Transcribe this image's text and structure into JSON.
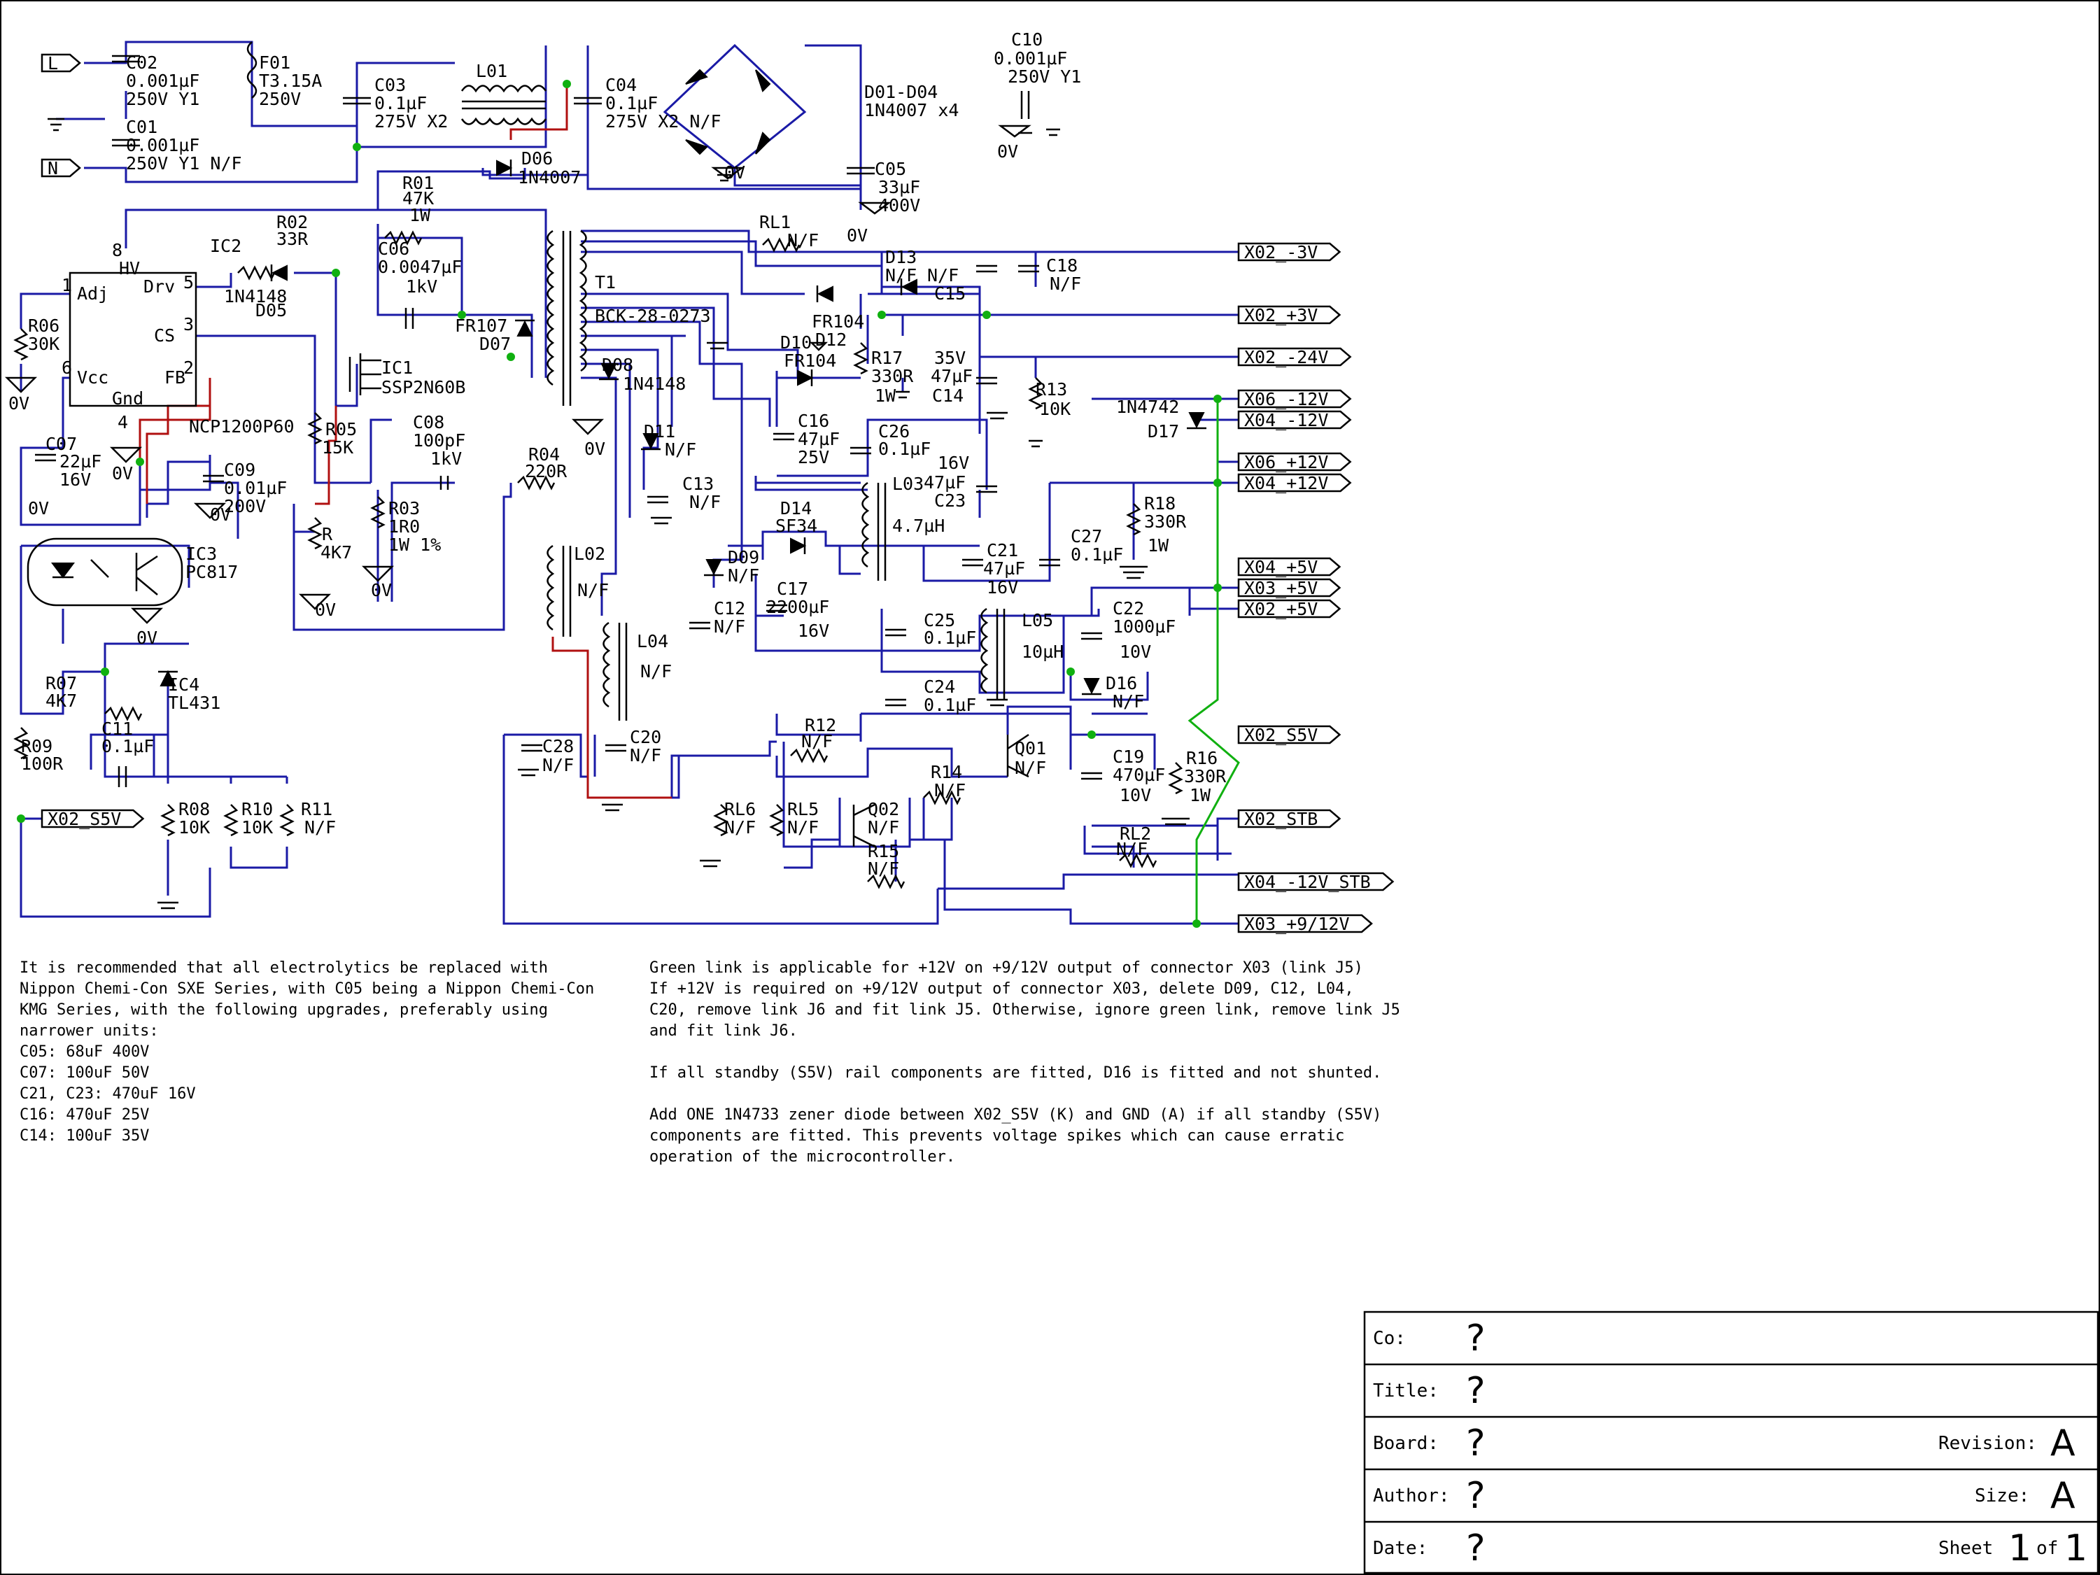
{
  "netlabels": [
    {
      "id": "L",
      "text": "L"
    },
    {
      "id": "N",
      "text": "N"
    },
    {
      "id": "x02_m3v",
      "text": "X02_-3V"
    },
    {
      "id": "x02_p3v",
      "text": "X02_+3V"
    },
    {
      "id": "x02_m24v",
      "text": "X02_-24V"
    },
    {
      "id": "x06_m12v",
      "text": "X06_-12V"
    },
    {
      "id": "x04_m12v",
      "text": "X04_-12V"
    },
    {
      "id": "x06_p12v",
      "text": "X06_+12V"
    },
    {
      "id": "x04_p12v",
      "text": "X04_+12V"
    },
    {
      "id": "x04_p5v",
      "text": "X04_+5V"
    },
    {
      "id": "x03_p5v",
      "text": "X03_+5V"
    },
    {
      "id": "x02_p5v",
      "text": "X02_+5V"
    },
    {
      "id": "x02_s5v",
      "text": "X02_S5V"
    },
    {
      "id": "x02_stb",
      "text": "X02_STB"
    },
    {
      "id": "x04_m12v_stb",
      "text": "X04_-12V_STB"
    },
    {
      "id": "x03_p9_12v",
      "text": "X03_+9/12V"
    },
    {
      "id": "x02_s5v_left",
      "text": "X02_S5V"
    }
  ],
  "labels": [
    {
      "t": "C02"
    },
    {
      "t": "0.001µF"
    },
    {
      "t": "250V Y1"
    },
    {
      "t": "C01"
    },
    {
      "t": "0.001µF"
    },
    {
      "t": "250V Y1 N/F"
    },
    {
      "t": "F01"
    },
    {
      "t": "T3.15A"
    },
    {
      "t": "250V"
    },
    {
      "t": "C03"
    },
    {
      "t": "0.1µF"
    },
    {
      "t": "275V X2"
    },
    {
      "t": "L01"
    },
    {
      "t": "C04"
    },
    {
      "t": "0.1µF"
    },
    {
      "t": "275V X2 N/F"
    },
    {
      "t": "D01-D04"
    },
    {
      "t": "1N4007 x4"
    },
    {
      "t": "C10"
    },
    {
      "t": "0.001µF"
    },
    {
      "t": "250V Y1"
    },
    {
      "t": "0V"
    },
    {
      "t": "0V"
    },
    {
      "t": "D06"
    },
    {
      "t": "1N4007"
    },
    {
      "t": "C05"
    },
    {
      "t": "33µF"
    },
    {
      "t": "400V"
    },
    {
      "t": "0V"
    },
    {
      "t": "R01"
    },
    {
      "t": "47K"
    },
    {
      "t": "1W"
    },
    {
      "t": "R02"
    },
    {
      "t": "33R"
    },
    {
      "t": "IC2"
    },
    {
      "t": "HV"
    },
    {
      "t": "8"
    },
    {
      "t": "1"
    },
    {
      "t": "Adj"
    },
    {
      "t": "Drv"
    },
    {
      "t": "5"
    },
    {
      "t": "CS"
    },
    {
      "t": "3"
    },
    {
      "t": "6"
    },
    {
      "t": "Vcc"
    },
    {
      "t": "FB"
    },
    {
      "t": "2"
    },
    {
      "t": "Gnd"
    },
    {
      "t": "4"
    },
    {
      "t": "NCP1200P60"
    },
    {
      "t": "1N4148"
    },
    {
      "t": "D05"
    },
    {
      "t": "C06"
    },
    {
      "t": "0.0047µF"
    },
    {
      "t": "1kV"
    },
    {
      "t": "FR107"
    },
    {
      "t": "D07"
    },
    {
      "t": "R06"
    },
    {
      "t": "30K"
    },
    {
      "t": "0V"
    },
    {
      "t": "IC1"
    },
    {
      "t": "SSP2N60B"
    },
    {
      "t": "C07"
    },
    {
      "t": "22µF"
    },
    {
      "t": "16V"
    },
    {
      "t": "0V"
    },
    {
      "t": "0V"
    },
    {
      "t": "C09"
    },
    {
      "t": "0.01µF"
    },
    {
      "t": "200V"
    },
    {
      "t": "0V"
    },
    {
      "t": "R05"
    },
    {
      "t": "15K"
    },
    {
      "t": "C08"
    },
    {
      "t": "100pF"
    },
    {
      "t": "1kV"
    },
    {
      "t": "R03"
    },
    {
      "t": "1R0"
    },
    {
      "t": "1W 1%"
    },
    {
      "t": "0V"
    },
    {
      "t": "R"
    },
    {
      "t": "4K7"
    },
    {
      "t": "0V"
    },
    {
      "t": "IC3"
    },
    {
      "t": "PC817"
    },
    {
      "t": "0V"
    },
    {
      "t": "R04"
    },
    {
      "t": "220R"
    },
    {
      "t": "T1"
    },
    {
      "t": "BCK-28-0273"
    },
    {
      "t": "D08"
    },
    {
      "t": "1N4148"
    },
    {
      "t": "0V"
    },
    {
      "t": "D11"
    },
    {
      "t": "N/F"
    },
    {
      "t": "C13"
    },
    {
      "t": "N/F"
    },
    {
      "t": "L02"
    },
    {
      "t": "N/F"
    },
    {
      "t": "RL1"
    },
    {
      "t": "N/F"
    },
    {
      "t": "D13"
    },
    {
      "t": "N/F"
    },
    {
      "t": "N/F"
    },
    {
      "t": "C15"
    },
    {
      "t": "C18"
    },
    {
      "t": "N/F"
    },
    {
      "t": "FR104"
    },
    {
      "t": "D12"
    },
    {
      "t": "D10"
    },
    {
      "t": "FR104"
    },
    {
      "t": "R17"
    },
    {
      "t": "330R"
    },
    {
      "t": "1W"
    },
    {
      "t": "35V"
    },
    {
      "t": "47µF"
    },
    {
      "t": "C14"
    },
    {
      "t": "R13"
    },
    {
      "t": "10K"
    },
    {
      "t": "1N4742"
    },
    {
      "t": "D17"
    },
    {
      "t": "C16"
    },
    {
      "t": "47µF"
    },
    {
      "t": "25V"
    },
    {
      "t": "C26"
    },
    {
      "t": "0.1µF"
    },
    {
      "t": "16V"
    },
    {
      "t": "47µF"
    },
    {
      "t": "C23"
    },
    {
      "t": "L03"
    },
    {
      "t": "4.7µH"
    },
    {
      "t": "R18"
    },
    {
      "t": "330R"
    },
    {
      "t": "1W"
    },
    {
      "t": "D14"
    },
    {
      "t": "SF34"
    },
    {
      "t": "C21"
    },
    {
      "t": "47µF"
    },
    {
      "t": "16V"
    },
    {
      "t": "C27"
    },
    {
      "t": "0.1µF"
    },
    {
      "t": "D09"
    },
    {
      "t": "N/F"
    },
    {
      "t": "C17"
    },
    {
      "t": "2200µF"
    },
    {
      "t": "16V"
    },
    {
      "t": "C12"
    },
    {
      "t": "N/F"
    },
    {
      "t": "L04"
    },
    {
      "t": "N/F"
    },
    {
      "t": "C25"
    },
    {
      "t": "0.1µF"
    },
    {
      "t": "L05"
    },
    {
      "t": "10µH"
    },
    {
      "t": "C22"
    },
    {
      "t": "1000µF"
    },
    {
      "t": "10V"
    },
    {
      "t": "C24"
    },
    {
      "t": "0.1µF"
    },
    {
      "t": "D16"
    },
    {
      "t": "N/F"
    },
    {
      "t": "R07"
    },
    {
      "t": "4K7"
    },
    {
      "t": "IC4"
    },
    {
      "t": "TL431"
    },
    {
      "t": "C11"
    },
    {
      "t": "0.1µF"
    },
    {
      "t": "R09"
    },
    {
      "t": "100R"
    },
    {
      "t": "C28"
    },
    {
      "t": "N/F"
    },
    {
      "t": "C20"
    },
    {
      "t": "N/F"
    },
    {
      "t": "R12"
    },
    {
      "t": "N/F"
    },
    {
      "t": "Q01"
    },
    {
      "t": "N/F"
    },
    {
      "t": "C19"
    },
    {
      "t": "470µF"
    },
    {
      "t": "10V"
    },
    {
      "t": "R16"
    },
    {
      "t": "330R"
    },
    {
      "t": "1W"
    },
    {
      "t": "R08"
    },
    {
      "t": "10K"
    },
    {
      "t": "R10"
    },
    {
      "t": "10K"
    },
    {
      "t": "R11"
    },
    {
      "t": "N/F"
    },
    {
      "t": "RL6"
    },
    {
      "t": "N/F"
    },
    {
      "t": "RL5"
    },
    {
      "t": "N/F"
    },
    {
      "t": "Q02"
    },
    {
      "t": "N/F"
    },
    {
      "t": "R14"
    },
    {
      "t": "N/F"
    },
    {
      "t": "R15"
    },
    {
      "t": "N/F"
    },
    {
      "t": "RL2"
    },
    {
      "t": "N/F"
    }
  ],
  "notes_left": [
    "It is recommended that all electrolytics be replaced with",
    "Nippon Chemi-Con SXE Series, with C05 being a Nippon Chemi-Con",
    "KMG Series, with the following upgrades, preferably using",
    "narrower units:",
    "C05: 68uF 400V",
    "C07: 100uF 50V",
    "C21, C23: 470uF 16V",
    "C16: 470uF 25V",
    "C14: 100uF 35V"
  ],
  "notes_right": [
    "Green link is applicable for +12V on +9/12V output of connector X03 (link J5)",
    "If +12V is required on +9/12V output of connector X03, delete D09, C12, L04,",
    "C20, remove link J6 and fit link J5. Otherwise, ignore green link, remove link J5",
    "and fit link J6.",
    "",
    "If all standby (S5V) rail components are fitted, D16 is fitted and not shunted.",
    "",
    "Add ONE 1N4733 zener diode between X02_S5V (K) and GND (A) if all standby (S5V)",
    "components are fitted. This prevents voltage spikes which can cause erratic",
    "operation of the microcontroller."
  ],
  "title_block": {
    "co_label": "Co:",
    "co_value": "?",
    "title_label": "Title:",
    "title_value": "?",
    "board_label": "Board:",
    "board_value": "?",
    "revision_label": "Revision:",
    "revision_value": "A",
    "author_label": "Author:",
    "author_value": "?",
    "size_label": "Size:",
    "size_value": "A",
    "date_label": "Date:",
    "date_value": "?",
    "sheet_label": "Sheet",
    "sheet_num": "1",
    "of_label": "of",
    "sheet_total": "1"
  },
  "colors": {
    "wire": "#1a1aa6",
    "red_link": "#b01010",
    "green_link": "#10b010"
  }
}
